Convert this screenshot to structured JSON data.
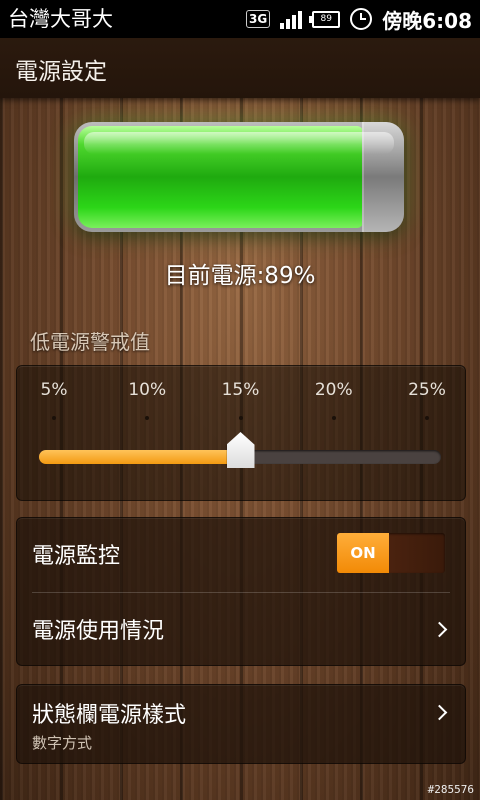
{
  "status_bar": {
    "carrier": "台灣大哥大",
    "network": "3G",
    "battery_level": "89",
    "time": "傍晚6:08"
  },
  "header": {
    "title": "電源設定"
  },
  "battery": {
    "level": 0.89,
    "text": "目前電源:89%"
  },
  "low_battery": {
    "label": "低電源警戒值",
    "ticks": [
      "5%",
      "10%",
      "15%",
      "20%",
      "25%"
    ],
    "selected_index": 2
  },
  "settings": {
    "monitor_label": "電源監控",
    "monitor_toggle": "ON",
    "usage_label": "電源使用情況",
    "statusbar_style_label": "狀態欄電源樣式",
    "statusbar_style_value": "數字方式"
  },
  "watermark": "#285576"
}
